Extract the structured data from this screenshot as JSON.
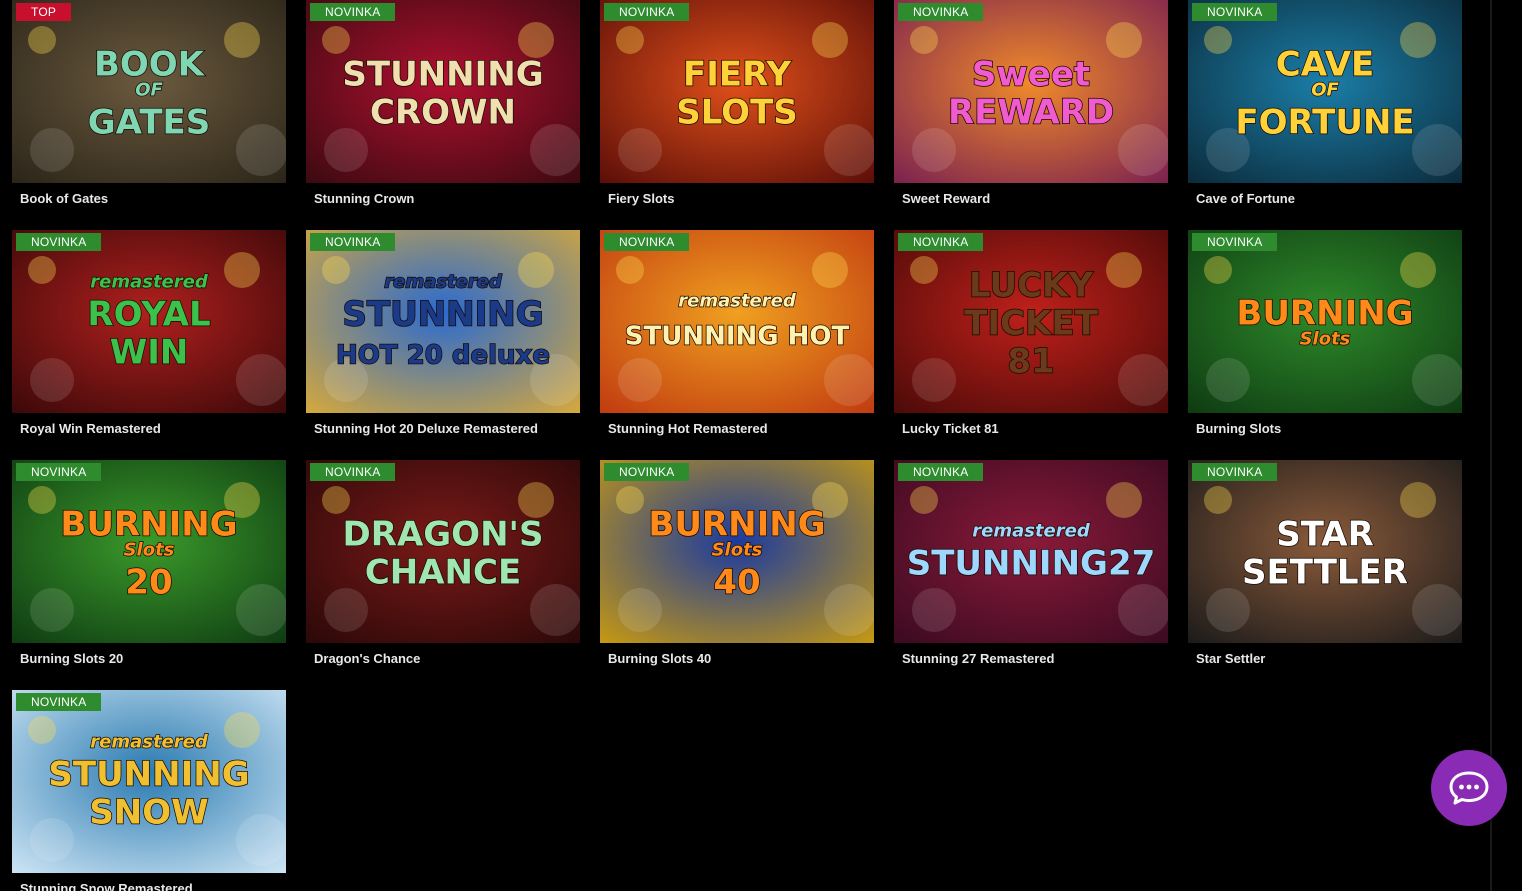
{
  "badges": {
    "top": "TOP",
    "new": "NOVINKA"
  },
  "games": [
    {
      "title": "Book of Gates",
      "badge": "TOP",
      "art_line1": "BOOK",
      "art_line2": "OF",
      "art_line3": "GATES",
      "bg": "#6b5a3e",
      "bg2": "#2a2418",
      "art_color": "#7fd6b3"
    },
    {
      "title": "Stunning Crown",
      "badge": "NOVINKA",
      "art_line1": "STUNNING",
      "art_line2": "CROWN",
      "art_line3": "",
      "bg": "#b01030",
      "bg2": "#3a0a10",
      "art_color": "#f0e0b0"
    },
    {
      "title": "Fiery Slots",
      "badge": "NOVINKA",
      "art_line1": "FIERY",
      "art_line2": "SLOTS",
      "art_line3": "",
      "bg": "#e0501a",
      "bg2": "#5a0d08",
      "art_color": "#ffd23a"
    },
    {
      "title": "Sweet Reward",
      "badge": "NOVINKA",
      "art_line1": "Sweet",
      "art_line2": "REWARD",
      "art_line3": "",
      "bg": "#f08a2a",
      "bg2": "#7a2050",
      "art_color": "#f25ad0"
    },
    {
      "title": "Cave of Fortune",
      "badge": "NOVINKA",
      "art_line1": "CAVE",
      "art_line2": "OF",
      "art_line3": "FORTUNE",
      "bg": "#1b7ea8",
      "bg2": "#0b2a3a",
      "art_color": "#ffd23a"
    },
    {
      "title": "Royal Win Remastered",
      "badge": "NOVINKA",
      "art_line1": "remastered",
      "art_line2": "ROYAL",
      "art_line3": "WIN",
      "bg": "#b0201e",
      "bg2": "#3a0808",
      "art_color": "#3cc24a"
    },
    {
      "title": "Stunning Hot 20 Deluxe Remastered",
      "badge": "NOVINKA",
      "art_line1": "remastered",
      "art_line2": "STUNNING",
      "art_line3": "HOT 20 deluxe",
      "bg": "#2a6ad0",
      "bg2": "#d8a93a",
      "art_color": "#1a3a8a"
    },
    {
      "title": "Stunning Hot Remastered",
      "badge": "NOVINKA",
      "art_line1": "remastered",
      "art_line2": "STUNNING HOT",
      "art_line3": "",
      "bg": "#f0a020",
      "bg2": "#c03a10",
      "art_color": "#fff2b0"
    },
    {
      "title": "Lucky Ticket 81",
      "badge": "NOVINKA",
      "art_line1": "LUCKY",
      "art_line2": "TICKET",
      "art_line3": "81",
      "bg": "#c0201a",
      "bg2": "#4a0a08",
      "art_color": "#6a3a1a"
    },
    {
      "title": "Burning Slots",
      "badge": "NOVINKA",
      "art_line1": "BURNING",
      "art_line2": "Slots",
      "art_line3": "",
      "bg": "#2e8a2a",
      "bg2": "#0e3a12",
      "art_color": "#ff8a1a"
    },
    {
      "title": "Burning Slots 20",
      "badge": "NOVINKA",
      "art_line1": "BURNING",
      "art_line2": "Slots",
      "art_line3": "20",
      "bg": "#3a9a2a",
      "bg2": "#0e3a12",
      "art_color": "#ff8a1a"
    },
    {
      "title": "Dragon's Chance",
      "badge": "NOVINKA",
      "art_line1": "DRAGON'S",
      "art_line2": "CHANCE",
      "art_line3": "",
      "bg": "#7a1a18",
      "bg2": "#2a0808",
      "art_color": "#9fe6b0"
    },
    {
      "title": "Burning Slots 40",
      "badge": "NOVINKA",
      "art_line1": "BURNING",
      "art_line2": "Slots",
      "art_line3": "40",
      "bg": "#1a3aa0",
      "bg2": "#c89a10",
      "art_color": "#ff8a1a"
    },
    {
      "title": "Stunning 27 Remastered",
      "badge": "NOVINKA",
      "art_line1": "remastered",
      "art_line2": "STUNNING27",
      "art_line3": "",
      "bg": "#8a1a3a",
      "bg2": "#3a0a20",
      "art_color": "#9fd8ff"
    },
    {
      "title": "Star Settler",
      "badge": "NOVINKA",
      "art_line1": "STAR",
      "art_line2": "SETTLER",
      "art_line3": "",
      "bg": "#8a5a3a",
      "bg2": "#1a1a1a",
      "art_color": "#ffffff"
    },
    {
      "title": "Stunning Snow Remastered",
      "badge": "NOVINKA",
      "art_line1": "remastered",
      "art_line2": "STUNNING",
      "art_line3": "SNOW",
      "bg": "#2a7ab0",
      "bg2": "#cfe6f5",
      "art_color": "#f0c030"
    }
  ],
  "chat": {
    "icon": "chat-bubble-icon",
    "color": "#8a2bb5"
  }
}
